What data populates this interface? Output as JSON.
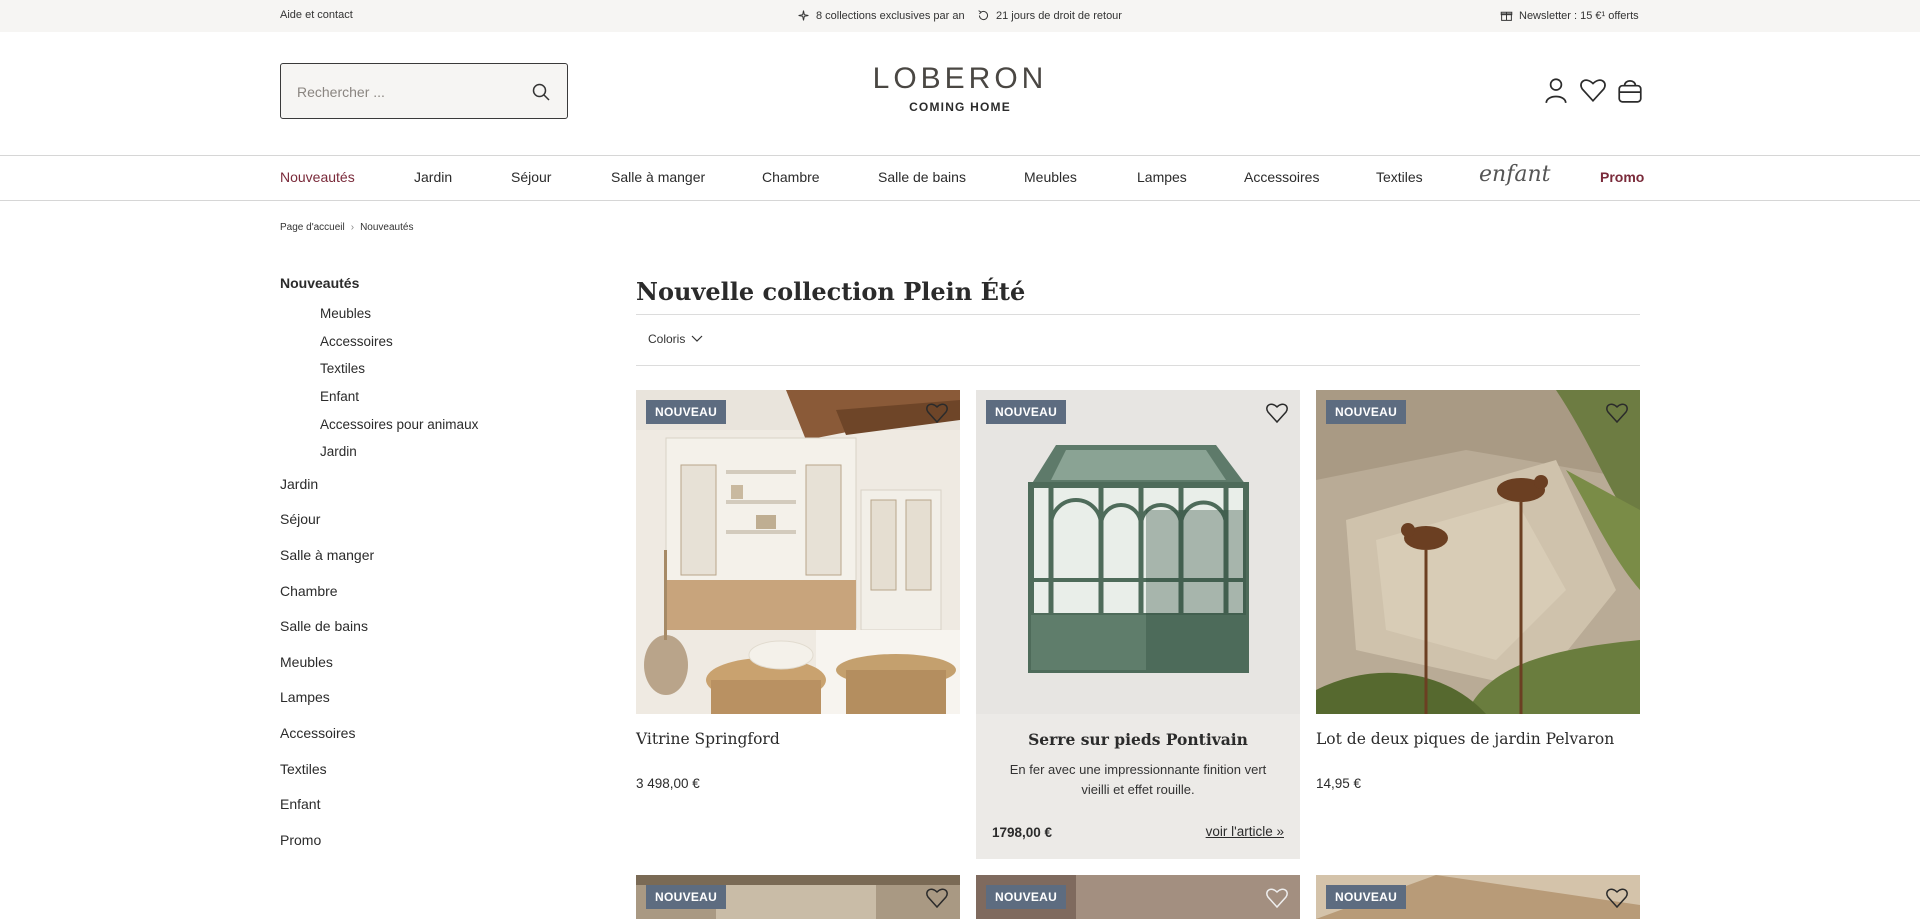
{
  "topbar": {
    "help": "Aide et contact",
    "collections": "8 collections exclusives par an",
    "returns": "21 jours de droit de retour",
    "newsletter": "Newsletter : 15 €¹ offerts"
  },
  "header": {
    "search_placeholder": "Rechercher ...",
    "logo": "LOBERON",
    "tagline": "COMING HOME"
  },
  "nav": {
    "items": [
      "Nouveautés",
      "Jardin",
      "Séjour",
      "Salle à manger",
      "Chambre",
      "Salle de bains",
      "Meubles",
      "Lampes",
      "Accessoires",
      "Textiles",
      "enfant",
      "Promo"
    ]
  },
  "breadcrumb": [
    "Page d'accueil",
    "Nouveautés"
  ],
  "sidebar": {
    "active": "Nouveautés",
    "subitems": [
      "Meubles",
      "Accessoires",
      "Textiles",
      "Enfant",
      "Accessoires pour animaux",
      "Jardin"
    ],
    "items": [
      "Jardin",
      "Séjour",
      "Salle à manger",
      "Chambre",
      "Salle de bains",
      "Meubles",
      "Lampes",
      "Accessoires",
      "Textiles",
      "Enfant",
      "Promo"
    ]
  },
  "main": {
    "title": "Nouvelle collection Plein Été",
    "filter": "Coloris",
    "badge": "NOUVEAU",
    "products": [
      {
        "name": "Vitrine Springford",
        "price": "3 498,00 €"
      },
      {
        "name": "Serre sur pieds Pontivain",
        "description": "En fer avec une impressionnante finition vert vieilli et effet rouille.",
        "price": "1798,00 €",
        "link": "voir l'article »"
      },
      {
        "name": "Lot de deux piques de jardin Pelvaron",
        "price": "14,95 €"
      }
    ]
  },
  "colors": {
    "accent": "#7a2a3a",
    "badge": "#5d6c80",
    "topbar_bg": "#f6f5f3",
    "featured_bg": "#eceae7"
  }
}
